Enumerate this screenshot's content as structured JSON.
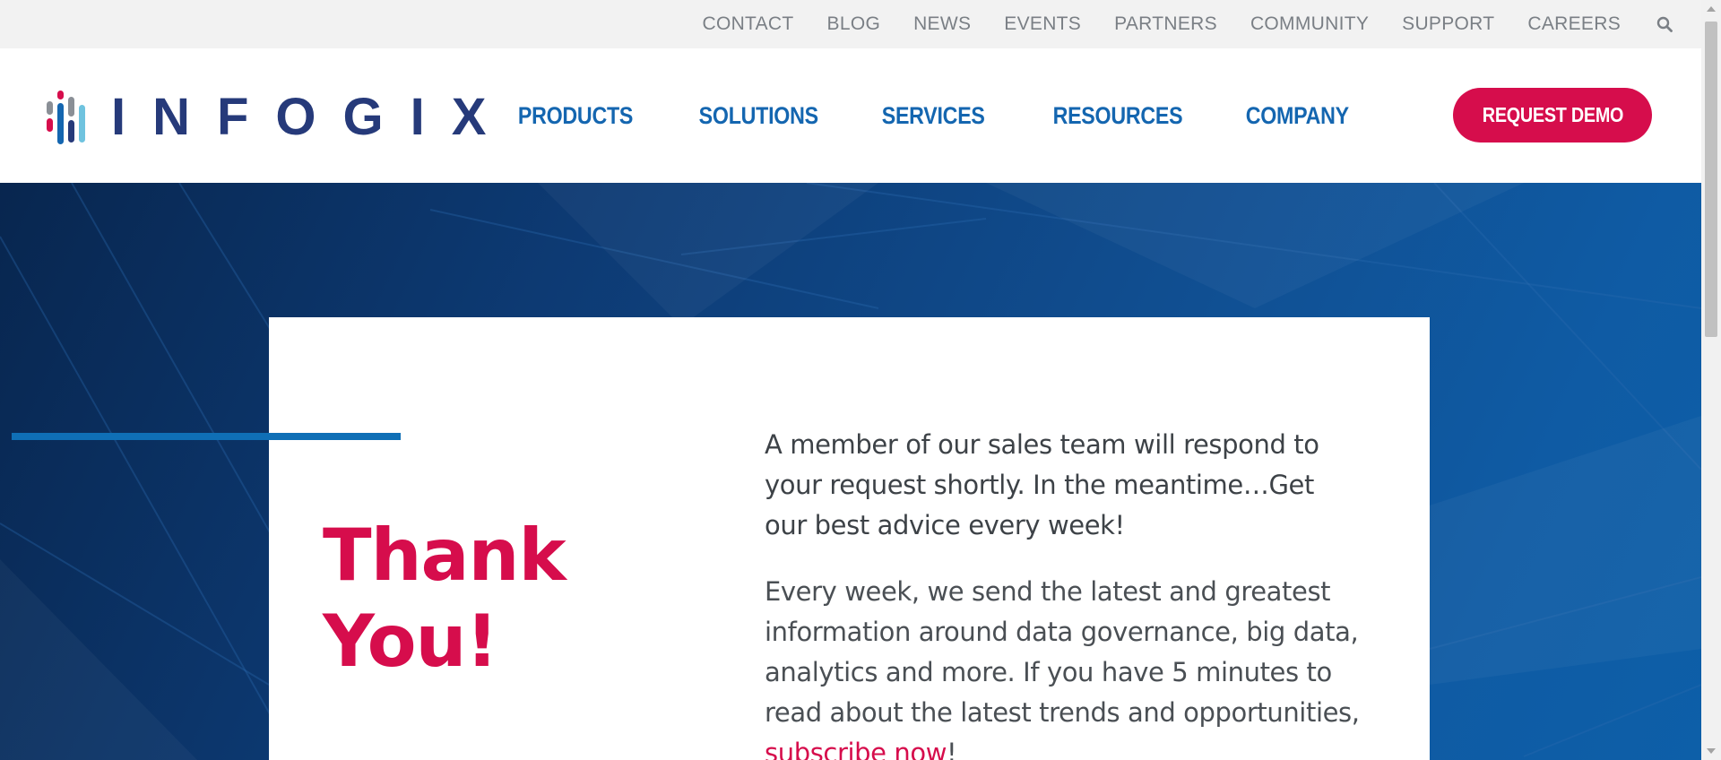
{
  "utility_nav": {
    "items": [
      "CONTACT",
      "BLOG",
      "NEWS",
      "EVENTS",
      "PARTNERS",
      "COMMUNITY",
      "SUPPORT",
      "CAREERS"
    ],
    "search_icon": "search-icon"
  },
  "header": {
    "logo_text": "INFOGIX",
    "nav": [
      "PRODUCTS",
      "SOLUTIONS",
      "SERVICES",
      "RESOURCES",
      "COMPANY"
    ],
    "cta_label": "REQUEST DEMO"
  },
  "hero": {
    "heading": "Thank You!",
    "lead": "A member of our sales team will respond to your request shortly. In the meantime…Get our best advice every week!",
    "body": "Every week, we send the latest and greatest information around data governance, big data, analytics and more. If you have 5 minutes to read about the latest trends and opportunities,",
    "link_text": "subscribe now",
    "link_suffix": "!"
  },
  "colors": {
    "brand_navy": "#263a7a",
    "nav_blue": "#1466b0",
    "accent_red": "#d60d4c",
    "logo_gray": "#8a8f96",
    "logo_light_blue": "#6fc3df"
  }
}
